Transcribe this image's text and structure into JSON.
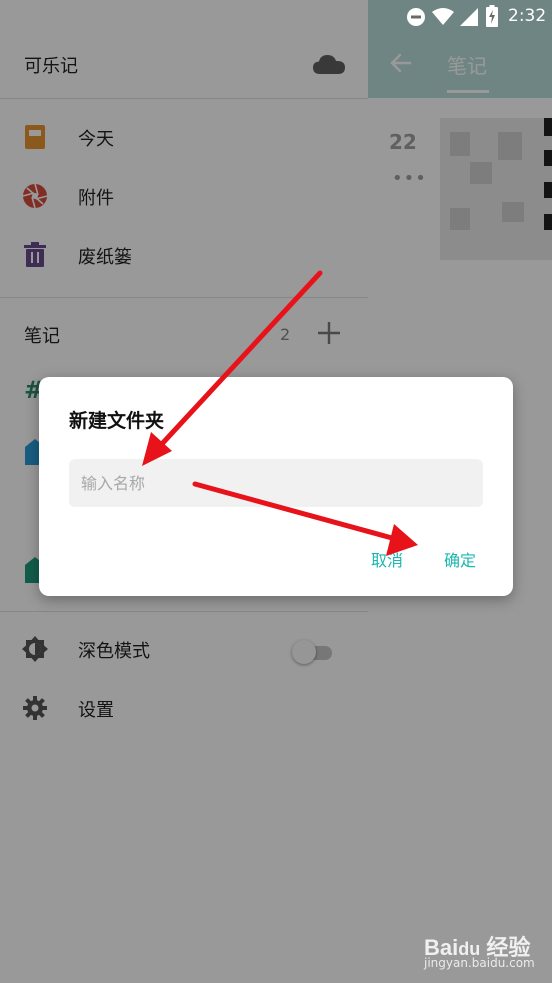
{
  "status_bar": {
    "time": "2:32"
  },
  "background": {
    "title": "笔记",
    "date": "22",
    "dots": "•••"
  },
  "drawer": {
    "title": "可乐记",
    "nav": [
      {
        "label": "今天",
        "icon": "calendar-icon"
      },
      {
        "label": "附件",
        "icon": "aperture-icon"
      },
      {
        "label": "废纸篓",
        "icon": "trash-icon"
      }
    ],
    "section": {
      "label": "笔记",
      "count": "2"
    },
    "hash": "#",
    "dark_mode": {
      "label": "深色模式",
      "enabled": false
    },
    "settings": {
      "label": "设置"
    }
  },
  "dialog": {
    "title": "新建文件夹",
    "placeholder": "输入名称",
    "value": "",
    "cancel": "取消",
    "confirm": "确定"
  },
  "colors": {
    "accent": "#1bb7b0",
    "header": "#b8dedd",
    "calendar": "#e8942e",
    "aperture": "#d64c3c",
    "trash": "#6a4a8c",
    "tag_blue": "#2a9bd6",
    "tag_green": "#1f9c7c",
    "arrow": "#e8121a"
  }
}
